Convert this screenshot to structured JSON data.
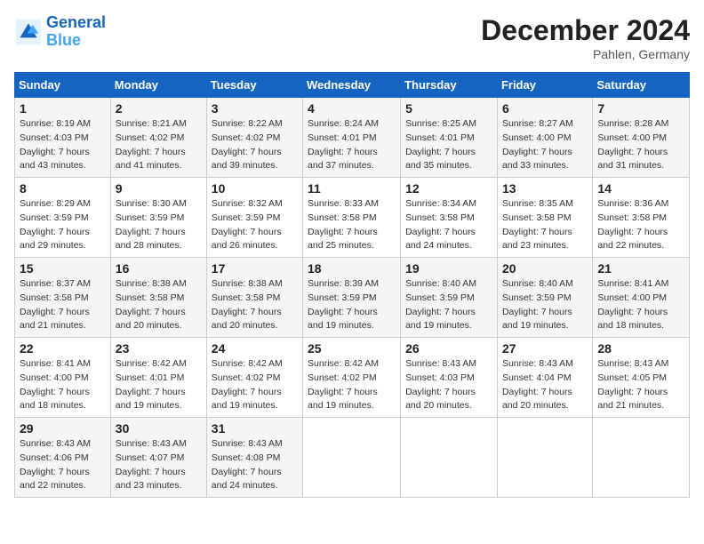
{
  "logo": {
    "line1": "General",
    "line2": "Blue"
  },
  "title": "December 2024",
  "location": "Pahlen, Germany",
  "days_of_week": [
    "Sunday",
    "Monday",
    "Tuesday",
    "Wednesday",
    "Thursday",
    "Friday",
    "Saturday"
  ],
  "weeks": [
    [
      {
        "day": "1",
        "sunrise": "8:19 AM",
        "sunset": "4:03 PM",
        "daylight": "7 hours and 43 minutes."
      },
      {
        "day": "2",
        "sunrise": "8:21 AM",
        "sunset": "4:02 PM",
        "daylight": "7 hours and 41 minutes."
      },
      {
        "day": "3",
        "sunrise": "8:22 AM",
        "sunset": "4:02 PM",
        "daylight": "7 hours and 39 minutes."
      },
      {
        "day": "4",
        "sunrise": "8:24 AM",
        "sunset": "4:01 PM",
        "daylight": "7 hours and 37 minutes."
      },
      {
        "day": "5",
        "sunrise": "8:25 AM",
        "sunset": "4:01 PM",
        "daylight": "7 hours and 35 minutes."
      },
      {
        "day": "6",
        "sunrise": "8:27 AM",
        "sunset": "4:00 PM",
        "daylight": "7 hours and 33 minutes."
      },
      {
        "day": "7",
        "sunrise": "8:28 AM",
        "sunset": "4:00 PM",
        "daylight": "7 hours and 31 minutes."
      }
    ],
    [
      {
        "day": "8",
        "sunrise": "8:29 AM",
        "sunset": "3:59 PM",
        "daylight": "7 hours and 29 minutes."
      },
      {
        "day": "9",
        "sunrise": "8:30 AM",
        "sunset": "3:59 PM",
        "daylight": "7 hours and 28 minutes."
      },
      {
        "day": "10",
        "sunrise": "8:32 AM",
        "sunset": "3:59 PM",
        "daylight": "7 hours and 26 minutes."
      },
      {
        "day": "11",
        "sunrise": "8:33 AM",
        "sunset": "3:58 PM",
        "daylight": "7 hours and 25 minutes."
      },
      {
        "day": "12",
        "sunrise": "8:34 AM",
        "sunset": "3:58 PM",
        "daylight": "7 hours and 24 minutes."
      },
      {
        "day": "13",
        "sunrise": "8:35 AM",
        "sunset": "3:58 PM",
        "daylight": "7 hours and 23 minutes."
      },
      {
        "day": "14",
        "sunrise": "8:36 AM",
        "sunset": "3:58 PM",
        "daylight": "7 hours and 22 minutes."
      }
    ],
    [
      {
        "day": "15",
        "sunrise": "8:37 AM",
        "sunset": "3:58 PM",
        "daylight": "7 hours and 21 minutes."
      },
      {
        "day": "16",
        "sunrise": "8:38 AM",
        "sunset": "3:58 PM",
        "daylight": "7 hours and 20 minutes."
      },
      {
        "day": "17",
        "sunrise": "8:38 AM",
        "sunset": "3:58 PM",
        "daylight": "7 hours and 20 minutes."
      },
      {
        "day": "18",
        "sunrise": "8:39 AM",
        "sunset": "3:59 PM",
        "daylight": "7 hours and 19 minutes."
      },
      {
        "day": "19",
        "sunrise": "8:40 AM",
        "sunset": "3:59 PM",
        "daylight": "7 hours and 19 minutes."
      },
      {
        "day": "20",
        "sunrise": "8:40 AM",
        "sunset": "3:59 PM",
        "daylight": "7 hours and 19 minutes."
      },
      {
        "day": "21",
        "sunrise": "8:41 AM",
        "sunset": "4:00 PM",
        "daylight": "7 hours and 18 minutes."
      }
    ],
    [
      {
        "day": "22",
        "sunrise": "8:41 AM",
        "sunset": "4:00 PM",
        "daylight": "7 hours and 18 minutes."
      },
      {
        "day": "23",
        "sunrise": "8:42 AM",
        "sunset": "4:01 PM",
        "daylight": "7 hours and 19 minutes."
      },
      {
        "day": "24",
        "sunrise": "8:42 AM",
        "sunset": "4:02 PM",
        "daylight": "7 hours and 19 minutes."
      },
      {
        "day": "25",
        "sunrise": "8:42 AM",
        "sunset": "4:02 PM",
        "daylight": "7 hours and 19 minutes."
      },
      {
        "day": "26",
        "sunrise": "8:43 AM",
        "sunset": "4:03 PM",
        "daylight": "7 hours and 20 minutes."
      },
      {
        "day": "27",
        "sunrise": "8:43 AM",
        "sunset": "4:04 PM",
        "daylight": "7 hours and 20 minutes."
      },
      {
        "day": "28",
        "sunrise": "8:43 AM",
        "sunset": "4:05 PM",
        "daylight": "7 hours and 21 minutes."
      }
    ],
    [
      {
        "day": "29",
        "sunrise": "8:43 AM",
        "sunset": "4:06 PM",
        "daylight": "7 hours and 22 minutes."
      },
      {
        "day": "30",
        "sunrise": "8:43 AM",
        "sunset": "4:07 PM",
        "daylight": "7 hours and 23 minutes."
      },
      {
        "day": "31",
        "sunrise": "8:43 AM",
        "sunset": "4:08 PM",
        "daylight": "7 hours and 24 minutes."
      },
      null,
      null,
      null,
      null
    ]
  ]
}
